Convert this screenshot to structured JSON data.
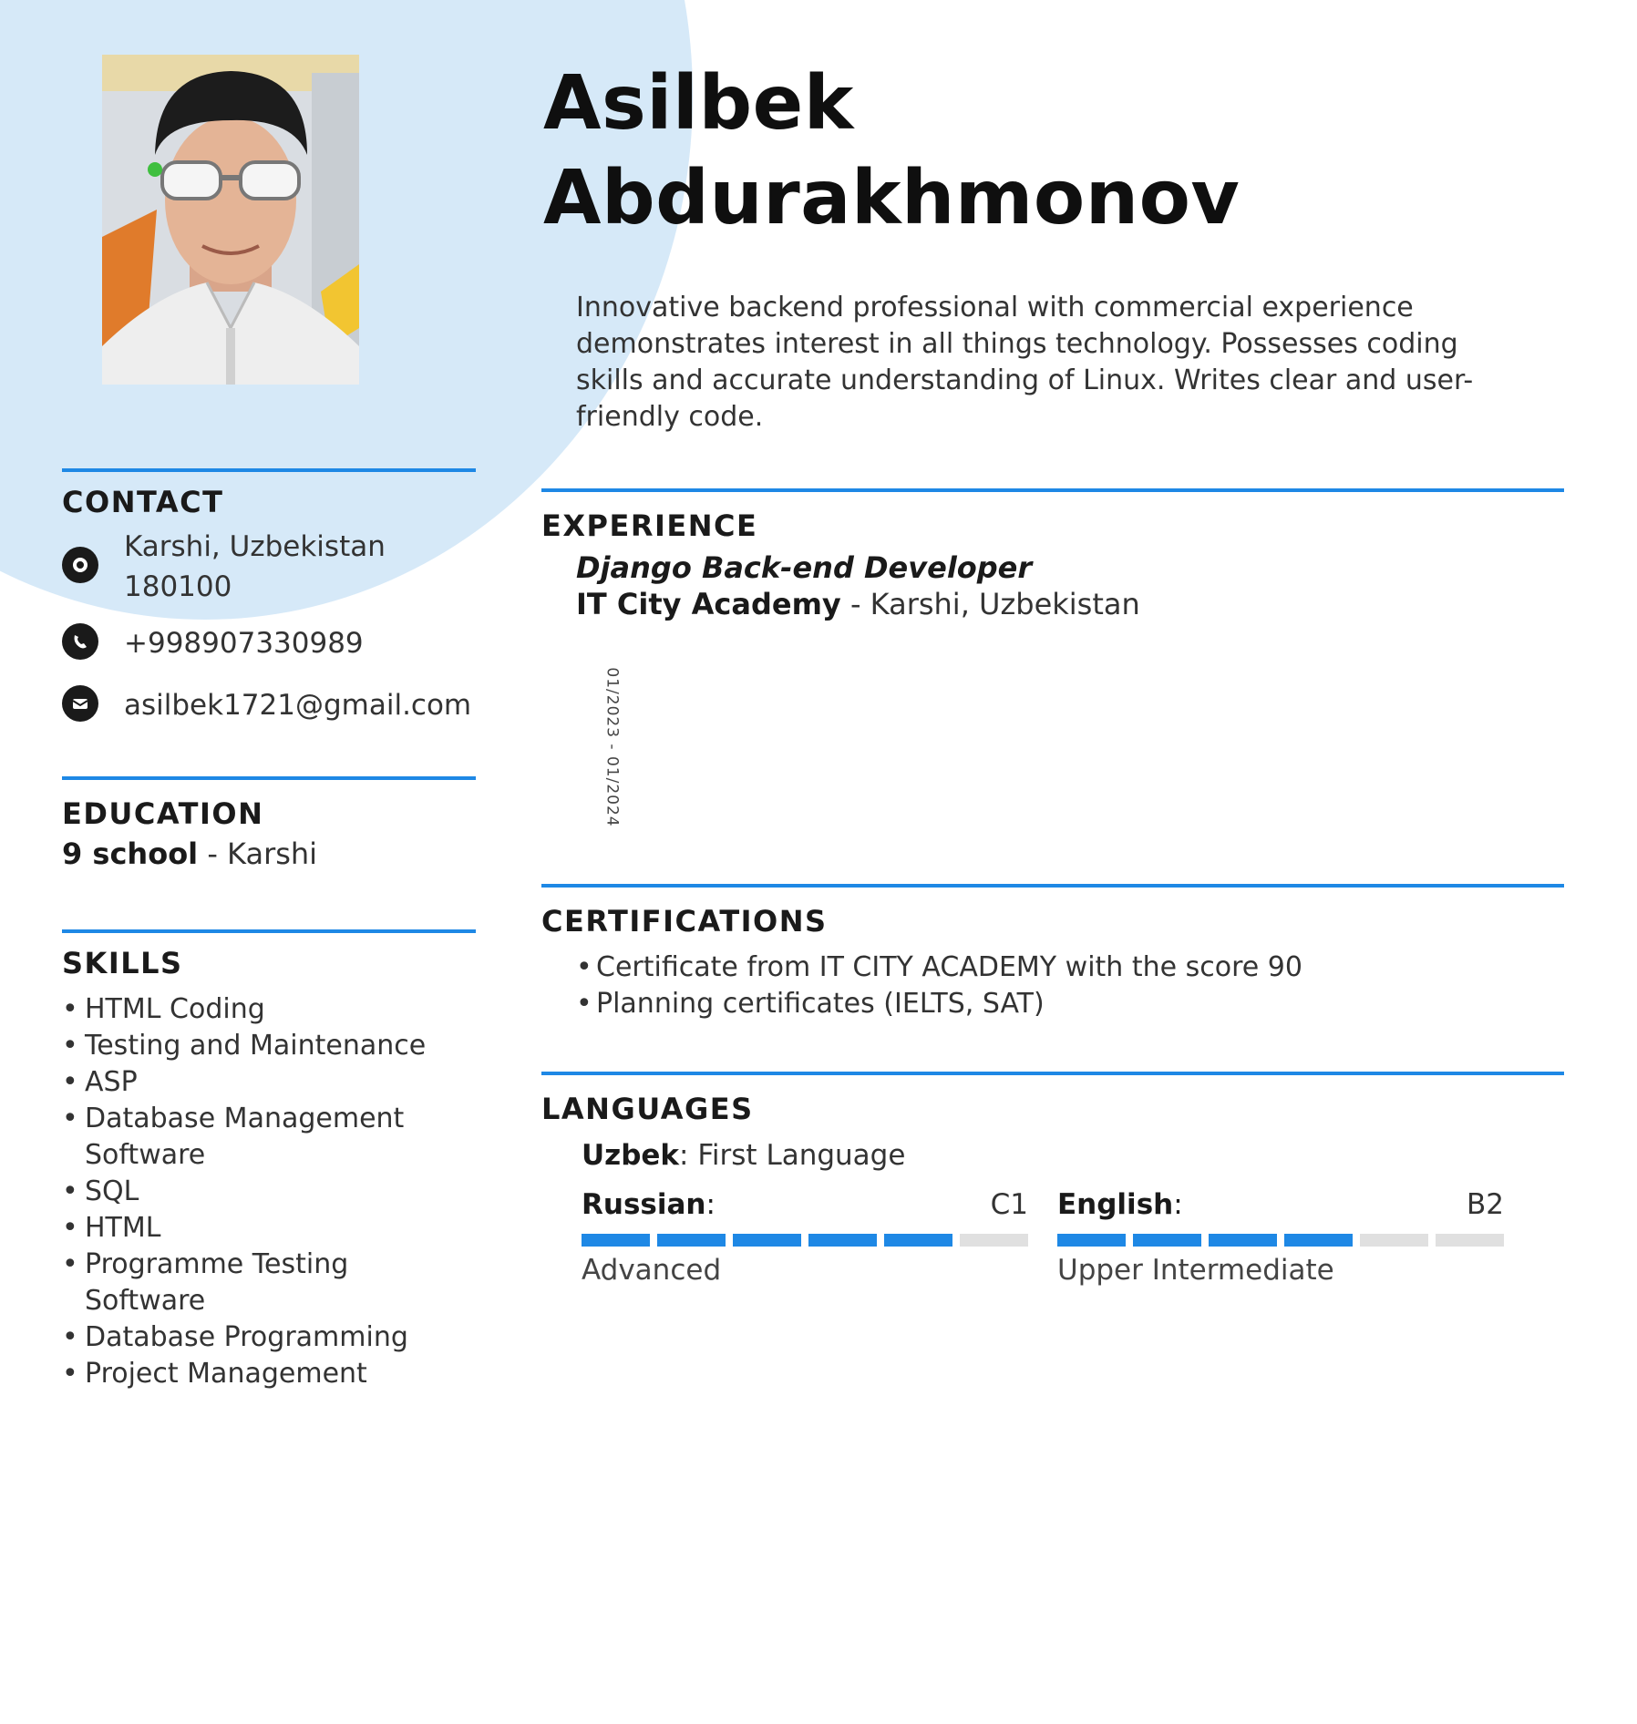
{
  "header": {
    "first_name": "Asilbek",
    "last_name": "Abdurakhmonov",
    "summary": "Innovative backend professional with commercial experience demonstrates interest in all things technology. Possesses coding skills and accurate understanding of Linux. Writes clear and user-friendly code."
  },
  "contact": {
    "title": "CONTACT",
    "address_line1": "Karshi, Uzbekistan",
    "address_line2": "180100",
    "phone": "+998907330989",
    "email": "asilbek1721@gmail.com"
  },
  "education": {
    "title": "EDUCATION",
    "school": "9 school",
    "location": " - Karshi"
  },
  "skills": {
    "title": "SKILLS",
    "items": [
      "HTML Coding",
      "Testing and Maintenance",
      "ASP",
      "Database Management Software",
      "SQL",
      "HTML",
      "Programme Testing Software",
      "Database Programming",
      "Project Management"
    ]
  },
  "experience": {
    "title": "EXPERIENCE",
    "job_title": "Django Back-end Developer",
    "company": "IT City Academy",
    "location": " - Karshi, Uzbekistan",
    "dates": "01/2023 - 01/2024"
  },
  "certifications": {
    "title": "CERTIFICATIONS",
    "items": [
      "Certificate from IT CITY ACADEMY with the score 90",
      "Planning certificates (IELTS, SAT)"
    ]
  },
  "languages": {
    "title": "LANGUAGES",
    "native_name": "Uzbek",
    "native_label": ": First Language",
    "list": [
      {
        "name": "Russian",
        "level": "C1",
        "desc": "Advanced",
        "filled": 5,
        "total": 6
      },
      {
        "name": "English",
        "level": "B2",
        "desc": "Upper Intermediate",
        "filled": 4,
        "total": 6
      }
    ]
  },
  "colors": {
    "accent": "#1e88e5",
    "background_circle": "#d6e9f8"
  }
}
